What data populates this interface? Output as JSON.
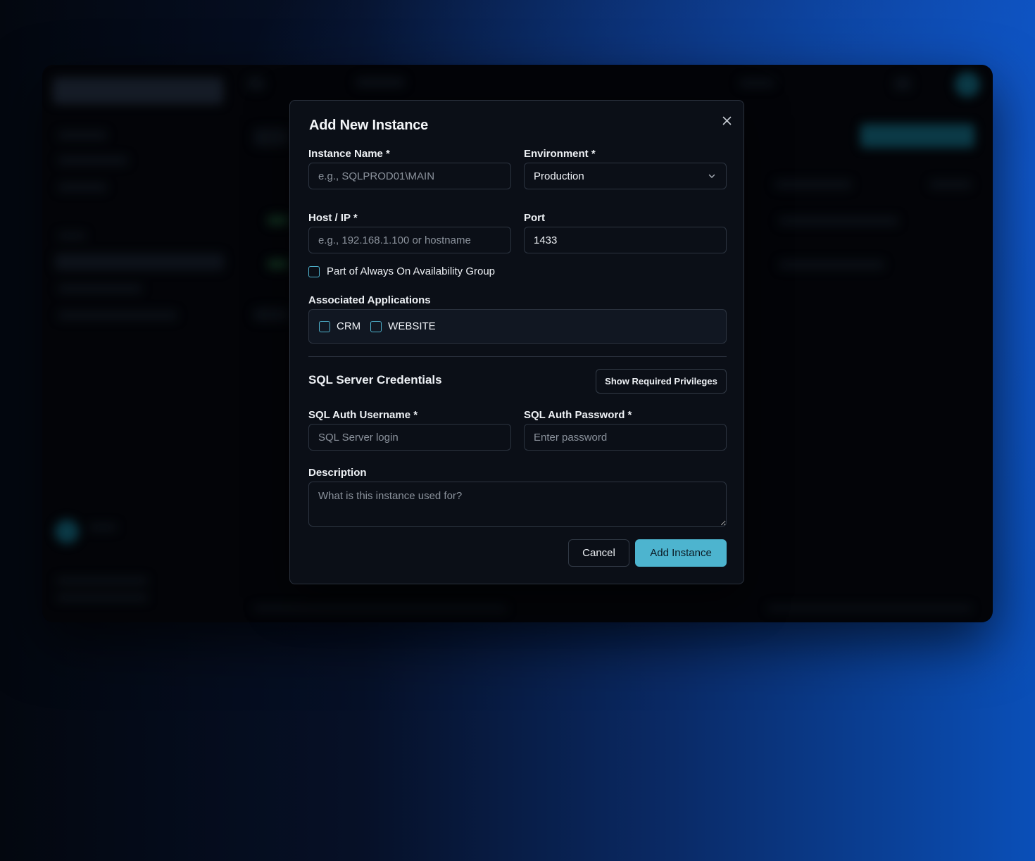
{
  "modal": {
    "title": "Add New Instance",
    "close_icon": "close-icon"
  },
  "form": {
    "instance_name": {
      "label": "Instance Name *",
      "placeholder": "e.g., SQLPROD01\\MAIN",
      "value": ""
    },
    "environment": {
      "label": "Environment *",
      "value": "Production"
    },
    "host": {
      "label": "Host / IP *",
      "placeholder": "e.g., 192.168.1.100 or hostname",
      "value": ""
    },
    "port": {
      "label": "Port",
      "value": "1433"
    },
    "availability_group": {
      "label": "Part of Always On Availability Group",
      "checked": false
    },
    "associated_applications": {
      "label": "Associated Applications",
      "options": [
        {
          "label": "CRM",
          "checked": false
        },
        {
          "label": "WEBSITE",
          "checked": false
        }
      ]
    },
    "credentials": {
      "title": "SQL Server Credentials",
      "privileges_button": "Show Required Privileges",
      "username": {
        "label": "SQL Auth Username *",
        "placeholder": "SQL Server login",
        "value": ""
      },
      "password": {
        "label": "SQL Auth Password *",
        "placeholder": "Enter password",
        "value": ""
      }
    },
    "description": {
      "label": "Description",
      "placeholder": "What is this instance used for?",
      "value": ""
    }
  },
  "actions": {
    "cancel_label": "Cancel",
    "submit_label": "Add Instance"
  },
  "colors": {
    "accent": "#4db4cf",
    "modal_bg": "#0b0f17",
    "border": "#2c3440"
  }
}
